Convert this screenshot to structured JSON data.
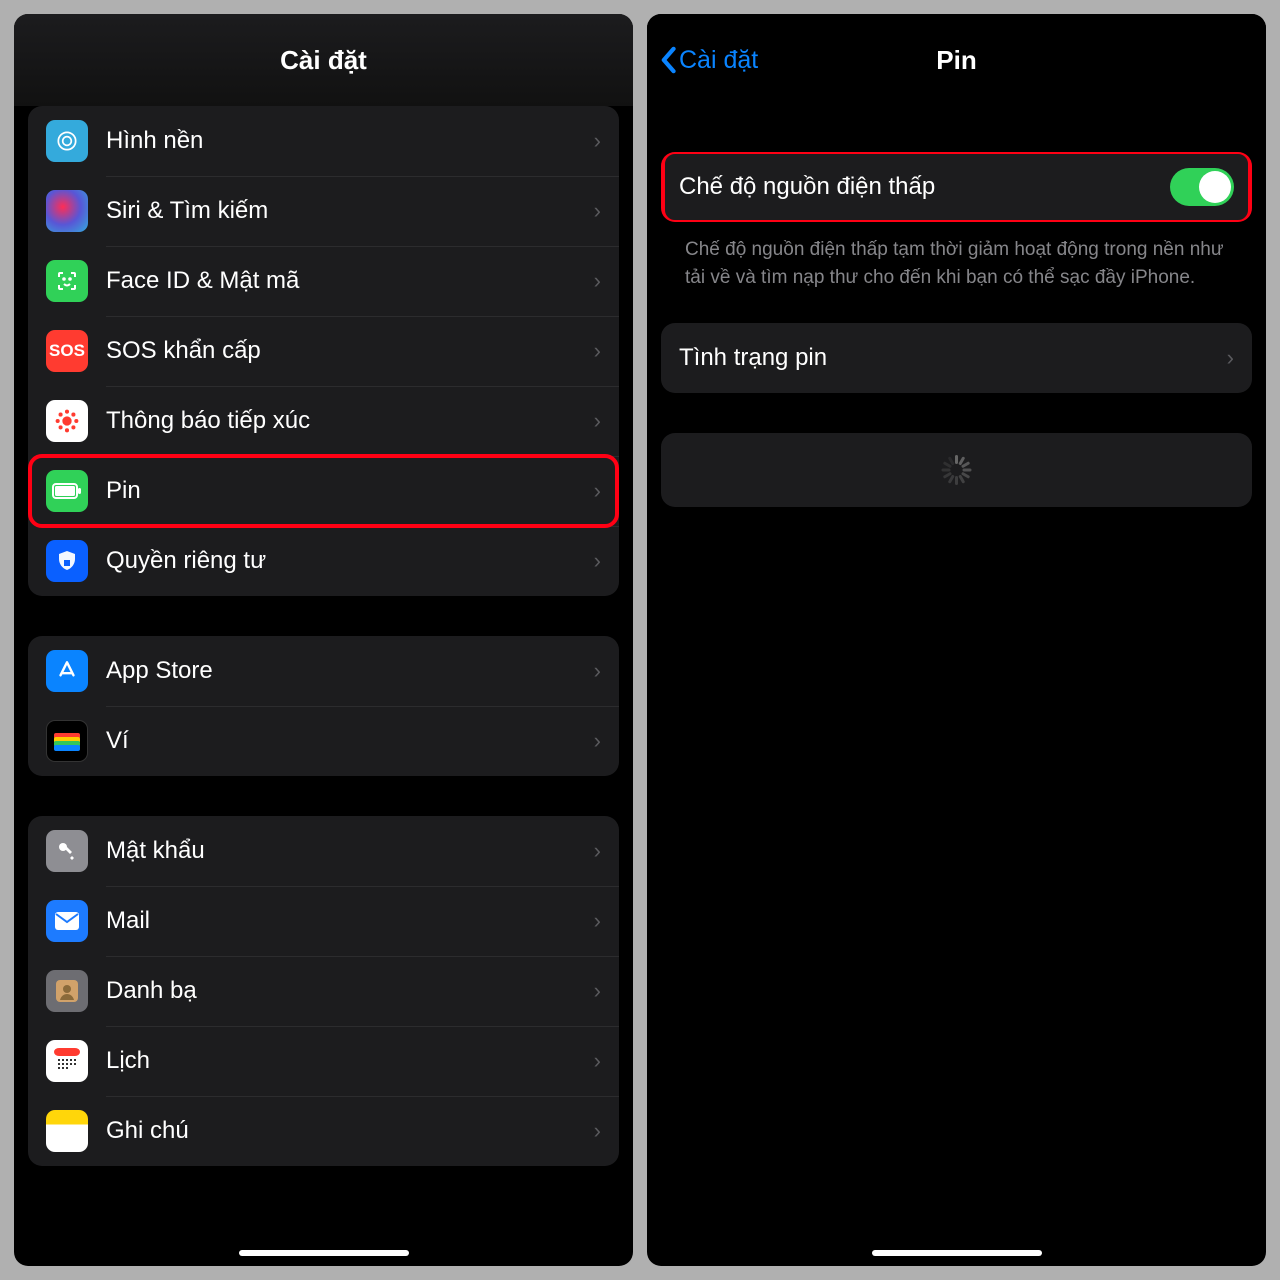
{
  "left": {
    "title": "Cài đặt",
    "groups": [
      {
        "items": [
          {
            "id": "wallpaper",
            "label": "Hình nền"
          },
          {
            "id": "siri",
            "label": "Siri & Tìm kiếm"
          },
          {
            "id": "faceid",
            "label": "Face ID & Mật mã"
          },
          {
            "id": "sos",
            "label": "SOS khẩn cấp"
          },
          {
            "id": "exposure",
            "label": "Thông báo tiếp xúc"
          },
          {
            "id": "battery",
            "label": "Pin",
            "highlight": true
          },
          {
            "id": "privacy",
            "label": "Quyền riêng tư"
          }
        ]
      },
      {
        "items": [
          {
            "id": "appstore",
            "label": "App Store"
          },
          {
            "id": "wallet",
            "label": "Ví"
          }
        ]
      },
      {
        "items": [
          {
            "id": "passwords",
            "label": "Mật khẩu"
          },
          {
            "id": "mail",
            "label": "Mail"
          },
          {
            "id": "contacts",
            "label": "Danh bạ"
          },
          {
            "id": "calendar",
            "label": "Lịch"
          },
          {
            "id": "notes",
            "label": "Ghi chú"
          }
        ]
      }
    ]
  },
  "right": {
    "back": "Cài đặt",
    "title": "Pin",
    "lowpower_label": "Chế độ nguồn điện thấp",
    "lowpower_on": true,
    "lowpower_desc": "Chế độ nguồn điện thấp tạm thời giảm hoạt động trong nền như tải về và tìm nạp thư cho đến khi bạn có thể sạc đầy iPhone.",
    "health_label": "Tình trạng pin"
  }
}
